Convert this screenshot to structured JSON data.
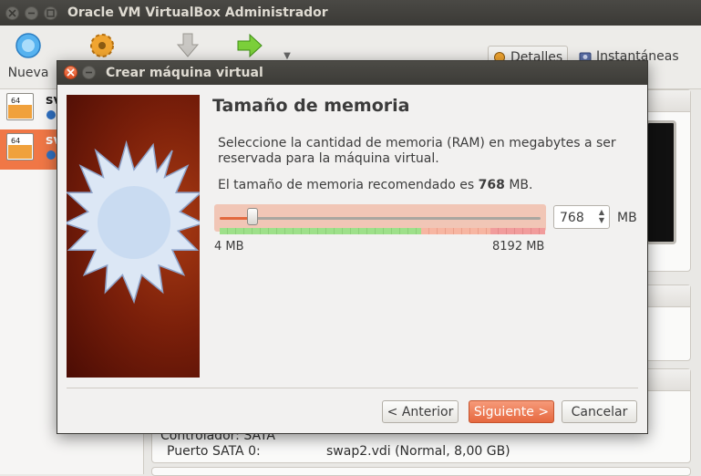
{
  "main_window": {
    "title": "Oracle VM VirtualBox Administrador",
    "toolbar": {
      "new_label": "Nueva",
      "details_label": "Detalles",
      "snapshots_label": "Instantáneas"
    },
    "vm_list": [
      {
        "name": "sv",
        "badge": "64",
        "selected": false
      },
      {
        "name": "sv",
        "badge": "64",
        "selected": true
      }
    ],
    "storage": {
      "controller": "Controlador: SATA",
      "port_label": "Puerto SATA 0:",
      "port_value": "swap2.vdi (Normal, 8,00 GB)"
    }
  },
  "dialog": {
    "title": "Crear máquina virtual",
    "heading": "Tamaño de memoria",
    "description": "Seleccione la cantidad de memoria (RAM) en megabytes a ser reservada para la máquina virtual.",
    "recommended_prefix": "El tamaño de memoria recomendado es",
    "recommended_value": "768",
    "recommended_unit": "MB.",
    "slider": {
      "min_label": "4 MB",
      "max_label": "8192 MB",
      "value": 768,
      "min": 4,
      "max": 8192
    },
    "memory_input": "768",
    "memory_unit": "MB",
    "buttons": {
      "back": "< Anterior",
      "next": "Siguiente >",
      "cancel": "Cancelar"
    }
  },
  "colors": {
    "accent": "#e6683f",
    "selection": "#f07746",
    "titlebar": "#3c3b37"
  }
}
